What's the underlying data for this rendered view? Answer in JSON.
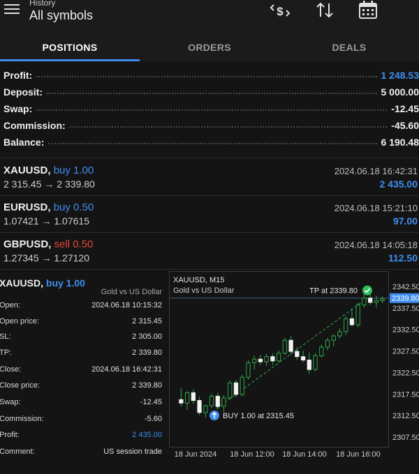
{
  "header": {
    "subtitle": "History",
    "title": "All symbols",
    "icons": [
      "currency-exchange-icon",
      "sort-icon",
      "calendar-icon"
    ]
  },
  "tabs": [
    {
      "label": "POSITIONS",
      "active": true
    },
    {
      "label": "ORDERS",
      "active": false
    },
    {
      "label": "DEALS",
      "active": false
    }
  ],
  "summary": [
    {
      "label": "Profit:",
      "value": "1 248.53",
      "color": "#3f8ef0"
    },
    {
      "label": "Deposit:",
      "value": "5 000.00",
      "color": "#f0f0f0"
    },
    {
      "label": "Swap:",
      "value": "-12.45",
      "color": "#f0f0f0"
    },
    {
      "label": "Commission:",
      "value": "-45.60",
      "color": "#f0f0f0"
    },
    {
      "label": "Balance:",
      "value": "6 190.48",
      "color": "#f0f0f0"
    }
  ],
  "positions": [
    {
      "symbol": "XAUUSD,",
      "direction": "buy 1.00",
      "side": "buy",
      "prices": "2 315.45 → 2 339.80",
      "time": "2024.06.18 16:42:31",
      "profit": "2 435.00"
    },
    {
      "symbol": "EURUSD,",
      "direction": "buy 0.50",
      "side": "buy",
      "prices": "1.07421 → 1.07615",
      "time": "2024.06.18 15:21:10",
      "profit": "97.00"
    },
    {
      "symbol": "GBPUSD,",
      "direction": "sell 0.50",
      "side": "sell",
      "prices": "1.27345 → 1.27120",
      "time": "2024.06.18 14:05:18",
      "profit": "112.50"
    }
  ],
  "detail": {
    "symbol": "XAUUSD,",
    "direction": "buy 1.00",
    "description": "Gold vs US Dollar",
    "rows": [
      {
        "key": "Open:",
        "value": "2024.06.18 10:15:32"
      },
      {
        "key": "Open price:",
        "value": "2 315.45"
      },
      {
        "key": "SL:",
        "value": "2 305.00"
      },
      {
        "key": "TP:",
        "value": "2 339.80"
      },
      {
        "key": "Close:",
        "value": "2024.06.18 16:42:31"
      },
      {
        "key": "Close price:",
        "value": "2 339.80"
      },
      {
        "key": "Swap:",
        "value": "-12.45"
      },
      {
        "key": "Commission:",
        "value": "-5.60"
      },
      {
        "key": "Profit:",
        "value": "2 435.00",
        "blue": true
      },
      {
        "key": "Comment:",
        "value": "US session trade"
      }
    ]
  },
  "chart_data": {
    "type": "candlestick",
    "title": "XAUUSD, M15",
    "subtitle": "Gold vs US Dollar",
    "y_ticks": [
      "2342.50",
      "2337.50",
      "2332.50",
      "2327.50",
      "2322.50",
      "2317.50",
      "2312.50",
      "2307.50"
    ],
    "y_tick_values": [
      2342.5,
      2337.5,
      2332.5,
      2327.5,
      2322.5,
      2317.5,
      2312.5,
      2307.5
    ],
    "x_ticks": [
      "18 Jun 2024",
      "18 Jun 12:00",
      "18 Jun 14:00",
      "18 Jun 16:00"
    ],
    "current_price_label": "2339.80",
    "tp_label": "TP at 2339.80",
    "buy_label": "BUY 1.00 at 2315.45",
    "entry_price": 2315.45,
    "exit_price": 2339.8,
    "candles": [
      [
        2316.2,
        2318.8,
        2314.6,
        2315.4
      ],
      [
        2315.4,
        2318.2,
        2313.8,
        2317.8
      ],
      [
        2317.8,
        2318.6,
        2315.2,
        2316.0
      ],
      [
        2316.0,
        2316.9,
        2312.6,
        2313.2
      ],
      [
        2313.2,
        2315.0,
        2312.0,
        2314.8
      ],
      [
        2314.8,
        2317.6,
        2314.2,
        2317.0
      ],
      [
        2317.0,
        2317.8,
        2314.0,
        2314.6
      ],
      [
        2314.6,
        2317.2,
        2313.4,
        2316.6
      ],
      [
        2316.6,
        2320.6,
        2316.2,
        2320.1
      ],
      [
        2320.1,
        2320.8,
        2316.8,
        2317.4
      ],
      [
        2317.4,
        2322.0,
        2317.0,
        2321.4
      ],
      [
        2321.4,
        2325.4,
        2320.8,
        2324.8
      ],
      [
        2324.8,
        2326.4,
        2323.2,
        2325.6
      ],
      [
        2325.6,
        2326.6,
        2324.2,
        2325.0
      ],
      [
        2325.0,
        2326.8,
        2324.0,
        2326.2
      ],
      [
        2326.2,
        2327.0,
        2324.2,
        2325.2
      ],
      [
        2325.2,
        2327.6,
        2324.8,
        2327.0
      ],
      [
        2327.0,
        2330.6,
        2326.6,
        2330.0
      ],
      [
        2330.0,
        2331.0,
        2326.6,
        2327.4
      ],
      [
        2327.4,
        2328.4,
        2325.4,
        2326.2
      ],
      [
        2326.2,
        2327.6,
        2324.8,
        2325.4
      ],
      [
        2325.4,
        2327.2,
        2322.2,
        2323.2
      ],
      [
        2323.2,
        2327.0,
        2322.8,
        2326.4
      ],
      [
        2326.4,
        2329.0,
        2326.0,
        2328.4
      ],
      [
        2328.4,
        2330.6,
        2327.6,
        2330.0
      ],
      [
        2330.0,
        2331.4,
        2328.6,
        2331.0
      ],
      [
        2331.0,
        2332.8,
        2330.4,
        2332.0
      ],
      [
        2332.0,
        2335.6,
        2331.2,
        2335.0
      ],
      [
        2335.0,
        2337.4,
        2333.2,
        2333.6
      ],
      [
        2333.6,
        2338.8,
        2333.0,
        2338.2
      ],
      [
        2338.2,
        2341.0,
        2337.6,
        2339.8
      ],
      [
        2339.8,
        2340.8,
        2338.2,
        2338.8
      ],
      [
        2338.8,
        2340.4,
        2337.6,
        2339.2
      ],
      [
        2339.2,
        2340.2,
        2338.6,
        2339.6
      ]
    ]
  }
}
